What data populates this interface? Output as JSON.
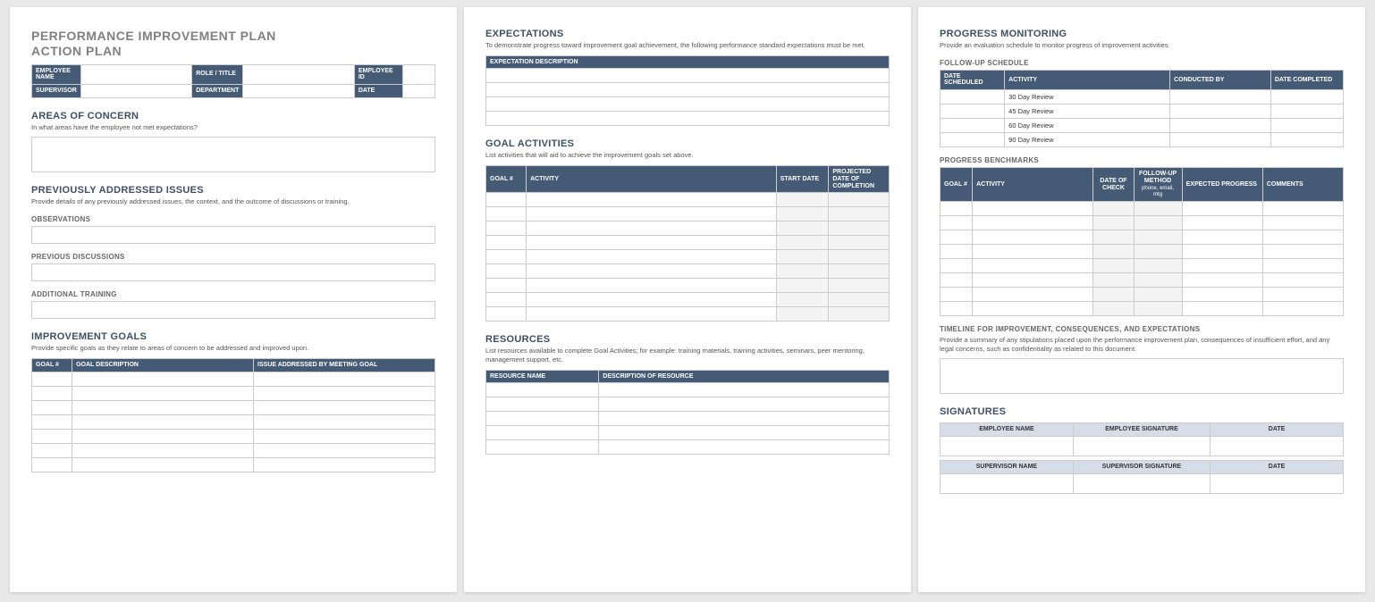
{
  "page1": {
    "title_line1": "PERFORMANCE IMPROVEMENT PLAN",
    "title_line2": "ACTION PLAN",
    "info": {
      "employee_name": "EMPLOYEE NAME",
      "role_title": "ROLE / TITLE",
      "employee_id": "EMPLOYEE ID",
      "supervisor": "SUPERVISOR",
      "department": "DEPARTMENT",
      "date": "DATE"
    },
    "areas": {
      "heading": "AREAS OF CONCERN",
      "sub": "In what areas have the employee not met expectations?"
    },
    "prev": {
      "heading": "PREVIOUSLY ADDRESSED ISSUES",
      "sub": "Provide details of any previously addressed issues, the context, and the outcome of discussions or training.",
      "observations": "OBSERVATIONS",
      "discussions": "PREVIOUS DISCUSSIONS",
      "training": "ADDITIONAL TRAINING"
    },
    "goals": {
      "heading": "IMPROVEMENT GOALS",
      "sub": "Provide specific goals as they relate to areas of concern to be addressed and improved upon.",
      "col_goal_num": "GOAL #",
      "col_goal_desc": "GOAL DESCRIPTION",
      "col_issue": "ISSUE ADDRESSED BY MEETING GOAL"
    }
  },
  "page2": {
    "expectations": {
      "heading": "EXPECTATIONS",
      "sub": "To demonstrate progress toward improvement goal achievement, the following performance standard expectations must be met.",
      "col": "EXPECTATION DESCRIPTION"
    },
    "activities": {
      "heading": "GOAL ACTIVITIES",
      "sub": "List activities that will aid to achieve the improvement goals set above.",
      "col_goal": "GOAL #",
      "col_activity": "ACTIVITY",
      "col_start": "START DATE",
      "col_end": "PROJECTED DATE OF COMPLETION"
    },
    "resources": {
      "heading": "RESOURCES",
      "sub": "List resources available to complete Goal Activities; for example: training materials, training activities, seminars, peer mentoring, management support, etc.",
      "col_name": "RESOURCE NAME",
      "col_desc": "DESCRIPTION OF RESOURCE"
    }
  },
  "page3": {
    "progress": {
      "heading": "PROGRESS MONITORING",
      "sub": "Provide an evaluation schedule to monitor progress of improvement activities.",
      "followup": "FOLLOW-UP SCHEDULE",
      "col_date_sched": "DATE SCHEDULED",
      "col_activity": "ACTIVITY",
      "col_conducted": "CONDUCTED BY",
      "col_completed": "DATE COMPLETED",
      "rows": [
        "30 Day Review",
        "45 Day Review",
        "60 Day Review",
        "90 Day Review"
      ],
      "benchmarks": "PROGRESS BENCHMARKS",
      "bcol_goal": "GOAL #",
      "bcol_activity": "ACTIVITY",
      "bcol_date_check": "DATE OF CHECK",
      "bcol_method": "FOLLOW-UP METHOD",
      "bcol_method_sub": "phone, email, mtg",
      "bcol_expected": "EXPECTED PROGRESS",
      "bcol_comments": "COMMENTS",
      "timeline": "TIMELINE FOR IMPROVEMENT, CONSEQUENCES, AND EXPECTATIONS",
      "timeline_sub": "Provide a summary of any stipulations placed upon the performance improvement plan, consequences of insufficient effort, and any legal concerns, such as confidentiality as related to this document."
    },
    "signatures": {
      "heading": "SIGNATURES",
      "emp_name": "EMPLOYEE NAME",
      "emp_sig": "EMPLOYEE SIGNATURE",
      "sup_name": "SUPERVISOR NAME",
      "sup_sig": "SUPERVISOR SIGNATURE",
      "date": "DATE"
    }
  }
}
